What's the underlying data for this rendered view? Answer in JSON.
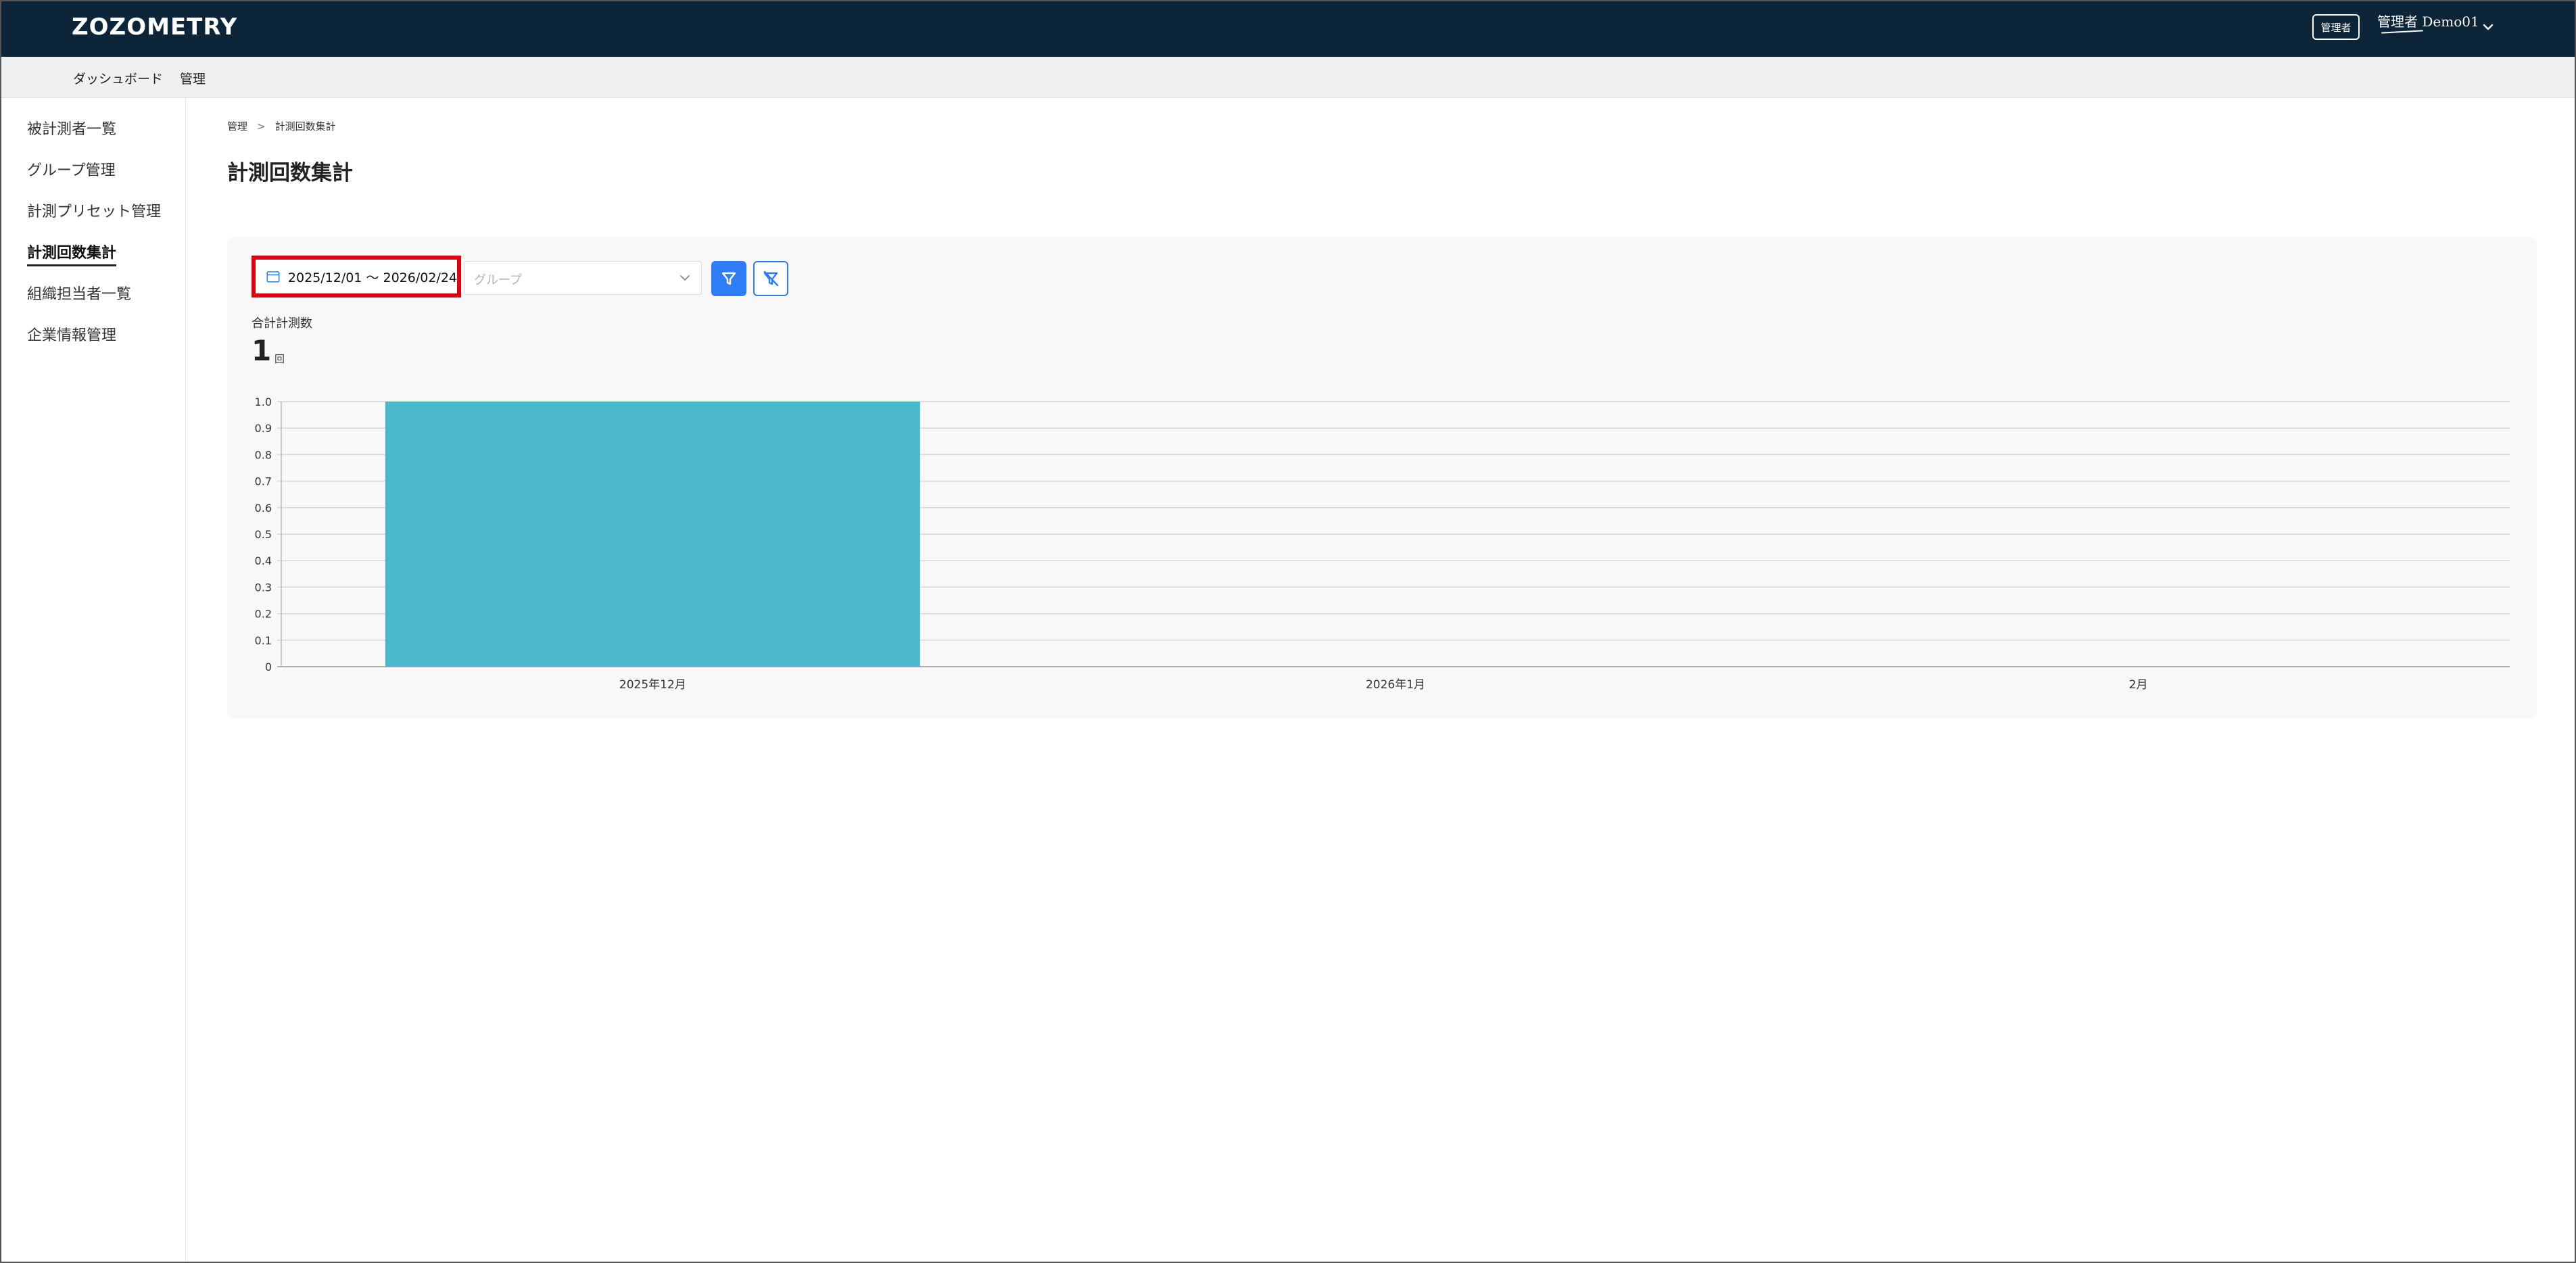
{
  "app": {
    "logo": "ZOZOMETRY",
    "role_badge": "管理者",
    "user_name": "管理者 Demo01"
  },
  "subnav": [
    "ダッシュボード",
    "管理"
  ],
  "sidebar": {
    "items": [
      {
        "label": "被計測者一覧",
        "active": false
      },
      {
        "label": "グループ管理",
        "active": false
      },
      {
        "label": "計測プリセット管理",
        "active": false
      },
      {
        "label": "計測回数集計",
        "active": true
      },
      {
        "label": "組織担当者一覧",
        "active": false
      },
      {
        "label": "企業情報管理",
        "active": false
      }
    ]
  },
  "breadcrumb": [
    "管理",
    "計測回数集計"
  ],
  "page_title": "計測回数集計",
  "filters": {
    "date_range": "2025/12/01 〜 2026/02/24",
    "group_placeholder": "グループ"
  },
  "summary": {
    "label": "合計計測数",
    "value": "1",
    "unit": "回"
  },
  "colors": {
    "header_bg": "#0c2538",
    "accent": "#2f7df6",
    "bar": "#4ab8c9",
    "highlight": "#e00010"
  },
  "icons": {
    "date": "calendar-icon",
    "select": "chevron-down-icon",
    "filter": "filter-icon",
    "clear": "filter-clear-icon",
    "user_menu": "chevron-down-icon"
  },
  "chart_data": {
    "type": "bar",
    "categories": [
      "2025年12月",
      "2026年1月",
      "2月"
    ],
    "values": [
      1,
      0,
      0
    ],
    "ylim": [
      0,
      1.0
    ],
    "yticks": [
      "0",
      "0.1",
      "0.2",
      "0.3",
      "0.4",
      "0.5",
      "0.6",
      "0.7",
      "0.8",
      "0.9",
      "1.0"
    ],
    "grid": true,
    "title": "",
    "xlabel": "",
    "ylabel": ""
  }
}
